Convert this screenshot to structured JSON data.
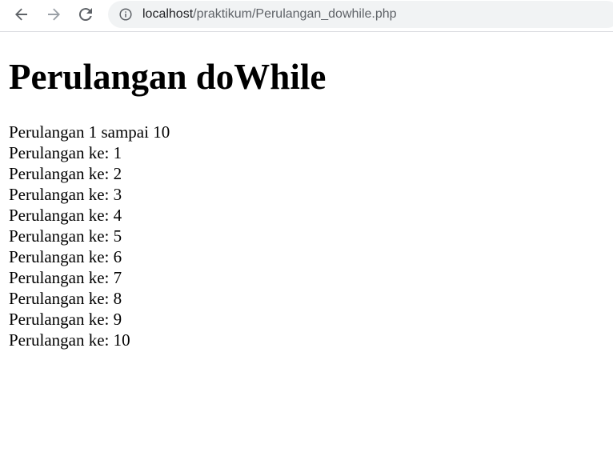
{
  "browser": {
    "url_host": "localhost",
    "url_path": "/praktikum/Perulangan_dowhile.php",
    "icons": {
      "back": "arrow-left-icon",
      "forward": "arrow-right-icon",
      "reload": "reload-icon",
      "site_info": "info-circle-icon"
    }
  },
  "page": {
    "heading": "Perulangan doWhile",
    "intro": "Perulangan 1 sampai 10",
    "lines": [
      "Perulangan ke: 1",
      "Perulangan ke: 2",
      "Perulangan ke: 3",
      "Perulangan ke: 4",
      "Perulangan ke: 5",
      "Perulangan ke: 6",
      "Perulangan ke: 7",
      "Perulangan ke: 8",
      "Perulangan ke: 9",
      "Perulangan ke: 10"
    ]
  },
  "colors": {
    "toolbar_icon": "#5f6368",
    "toolbar_icon_disabled": "#9aa0a6",
    "omnibox_bg": "#f1f3f4",
    "text": "#000000"
  }
}
